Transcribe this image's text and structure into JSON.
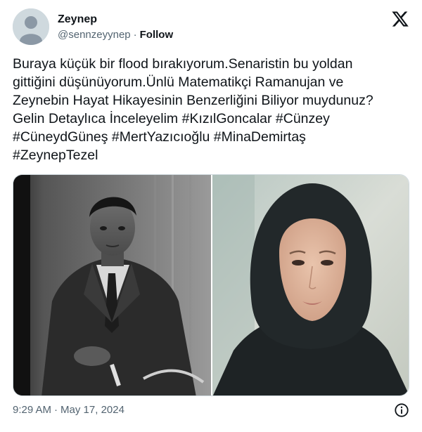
{
  "author": {
    "display_name": "Zeynep",
    "handle": "@sennzeyynep",
    "separator": "·",
    "follow_label": "Follow"
  },
  "tweet": {
    "text": "Buraya küçük bir flood bırakıyorum.Senaristin bu yoldan\ngittiğini düşünüyorum.Ünlü Matematikçi Ramanujan ve\nZeynebin Hayat Hikayesinin Benzerliğini Biliyor muydunuz?\nGelin Detaylıca İnceleyelim #KızılGoncalar #Cünzey\n#CüneydGüneş #MertYazıcıoğlu #MinaDemirtaş\n#ZeynepTezel",
    "time": "9:29 AM",
    "date_separator": "·",
    "date": "May 17, 2024"
  },
  "icons": {
    "avatar": "default-avatar-icon",
    "brand": "x-logo-icon",
    "info": "info-icon"
  },
  "media": [
    {
      "name": "photo-man-in-suit"
    },
    {
      "name": "photo-woman-in-hijab"
    }
  ],
  "colors": {
    "text_primary": "#0f1419",
    "text_secondary": "#536471",
    "border": "#cfd9de"
  }
}
